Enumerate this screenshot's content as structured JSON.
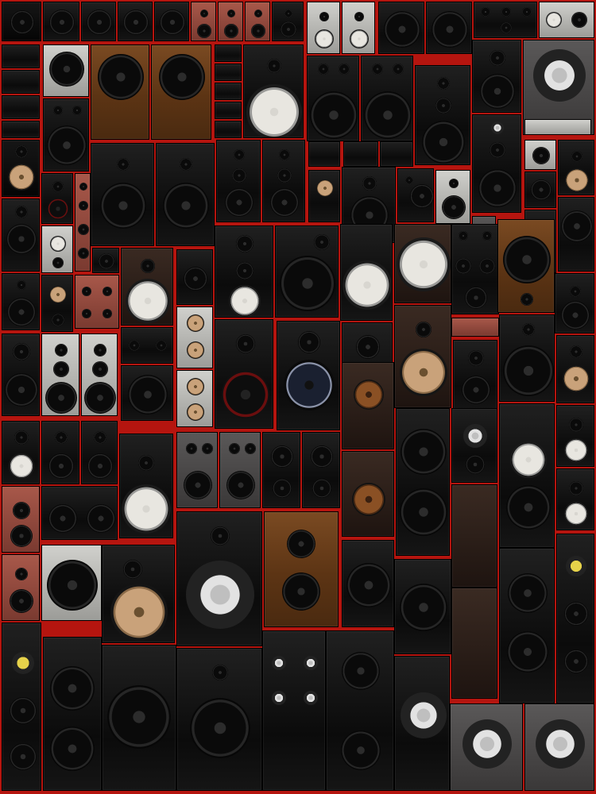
{
  "scene": {
    "subject": "wall-of-speakers",
    "palette": {
      "background": "#b5150f",
      "cabinet_black": "#111111",
      "cabinet_wood": "#6a3c18",
      "cabinet_silver": "#b8b8b4",
      "driver_cone_black": "#0a0a0a",
      "driver_cone_white": "#e8e6e0",
      "driver_cone_tan": "#c9a27a"
    }
  }
}
